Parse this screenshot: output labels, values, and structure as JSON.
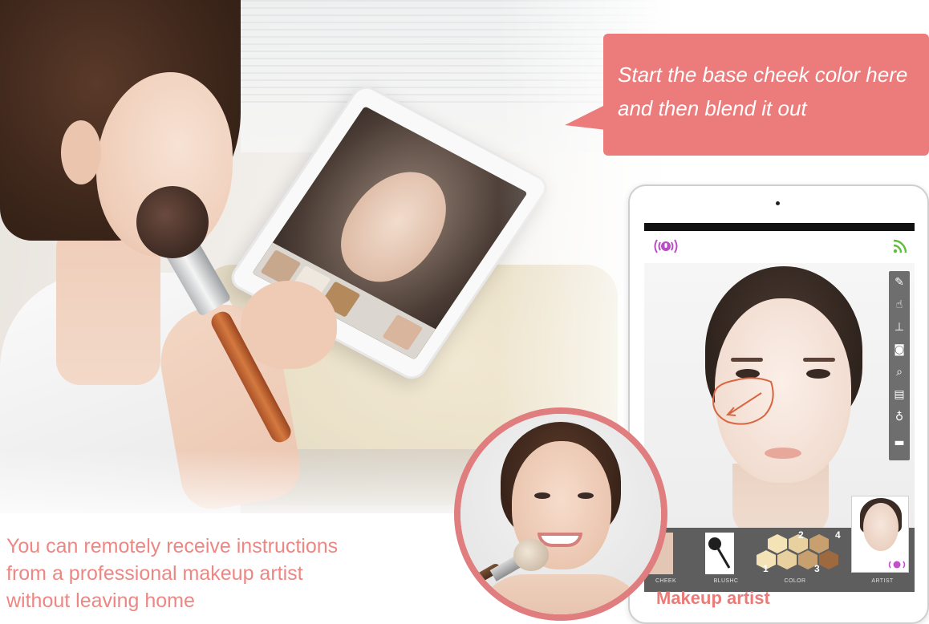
{
  "bubble": {
    "line1": "Start the base cheek color here",
    "line2": "and then blend it out"
  },
  "tagline": {
    "line1": "You can remotely receive instructions",
    "line2": "from a professional makeup artist",
    "line3": "without leaving home"
  },
  "caption": {
    "makeup_artist": "Makeup artist"
  },
  "app": {
    "bottom_labels": [
      "CHEEK",
      "BLUSHC",
      "COLOR",
      "ARTIST"
    ],
    "color_swatches": [
      "1",
      "2",
      "3",
      "4"
    ],
    "swatch_colors": [
      "#f4e3b7",
      "#e9d19f",
      "#c8a06f",
      "#9c6a3e"
    ],
    "tools": [
      "brush-icon",
      "hand-icon",
      "stamp-icon",
      "camera-icon",
      "search-icon",
      "gallery-icon",
      "microphone-icon",
      "folder-icon"
    ]
  },
  "colors": {
    "accent": "#ec7b7b",
    "caption": "#e97c78",
    "tagline": "#ec8783"
  }
}
